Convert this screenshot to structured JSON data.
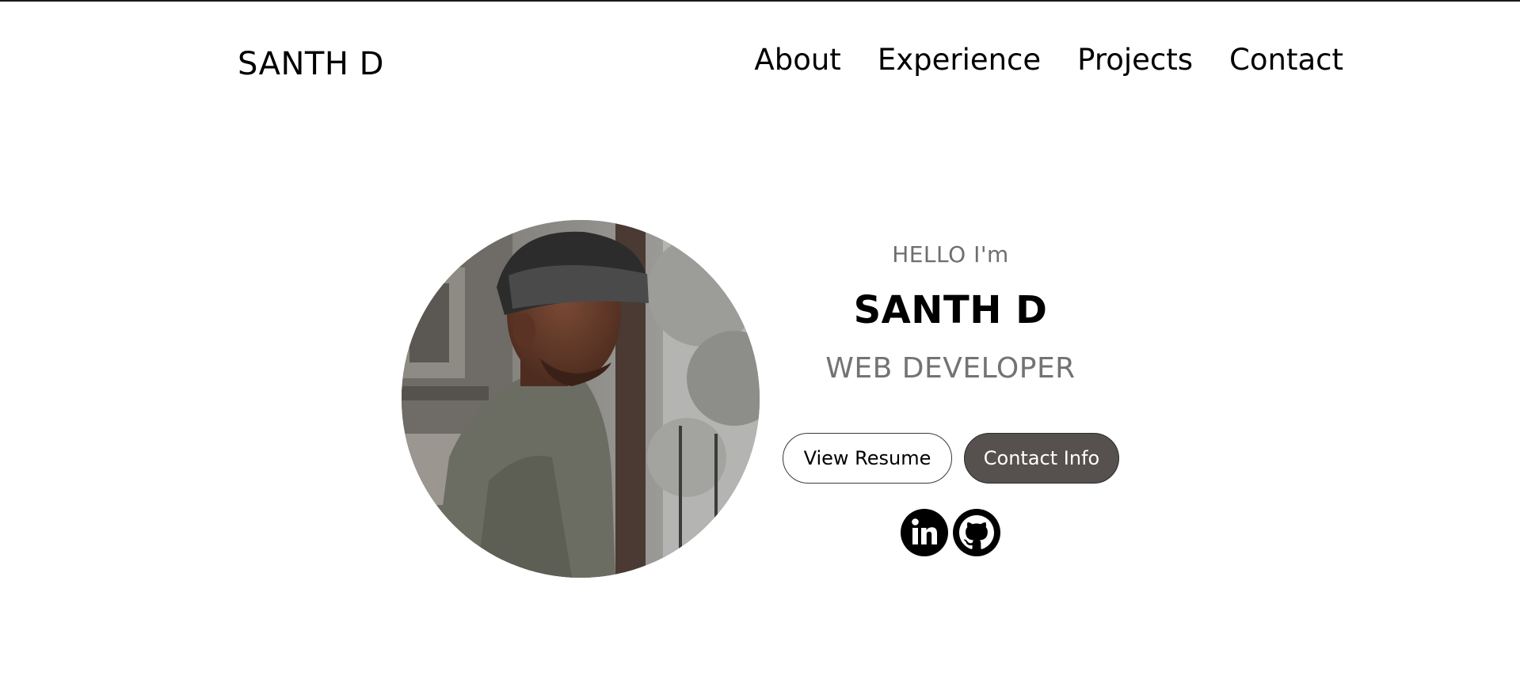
{
  "nav": {
    "logo": "SANTH D",
    "links": [
      {
        "label": "About"
      },
      {
        "label": "Experience"
      },
      {
        "label": "Projects"
      },
      {
        "label": "Contact"
      }
    ]
  },
  "hero": {
    "greeting": "HELLO I'm",
    "name": "SANTH D",
    "role": "WEB DEVELOPER",
    "buttons": {
      "resume": "View Resume",
      "contact": "Contact Info"
    },
    "socials": [
      {
        "icon": "linkedin-icon"
      },
      {
        "icon": "github-icon"
      }
    ],
    "profile_image_alt": "profile-photo"
  },
  "colors": {
    "text": "#000000",
    "muted_text": "#6e6e6e",
    "solid_button_bg": "#56504e",
    "solid_button_text": "#ffffff",
    "border": "#3a3a3a"
  }
}
